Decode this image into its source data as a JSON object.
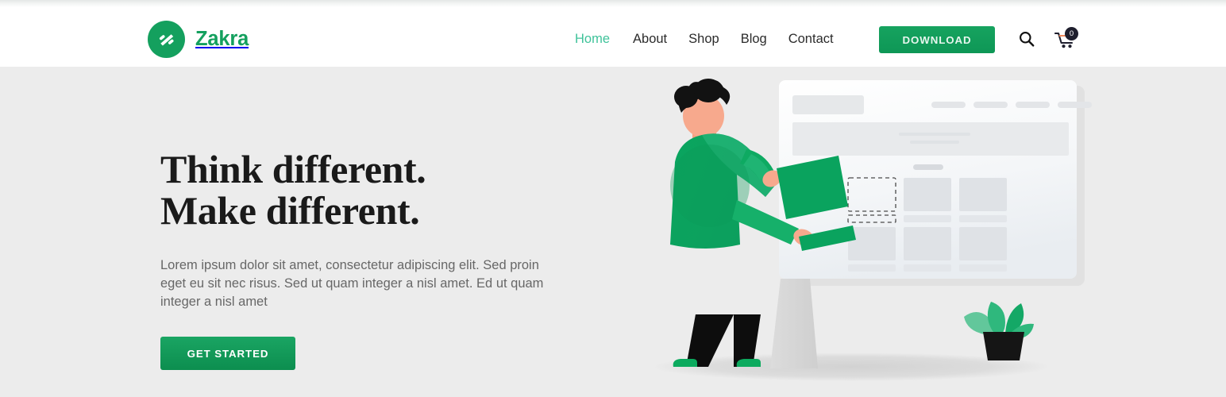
{
  "brand": {
    "name": "Zakra",
    "logo_icon": "zakra-logo-icon",
    "color": "#14a05e"
  },
  "nav": {
    "items": [
      {
        "label": "Home",
        "active": true
      },
      {
        "label": "About",
        "active": false
      },
      {
        "label": "Shop",
        "active": false
      },
      {
        "label": "Blog",
        "active": false
      },
      {
        "label": "Contact",
        "active": false
      }
    ]
  },
  "header_actions": {
    "download_label": "DOWNLOAD",
    "search_icon": "search-icon",
    "cart_icon": "shopping-cart-icon",
    "cart_count": "0"
  },
  "hero": {
    "title_line1": "Think different.",
    "title_line2": "Make different.",
    "description": "Lorem ipsum dolor sit amet, consectetur adipiscing elit. Sed proin eget eu sit nec risus. Sed ut quam integer a nisl amet.  Ed ut quam integer a nisl amet",
    "cta_label": "GET STARTED",
    "illustration": "website-builder-illustration",
    "background": "#ececec"
  },
  "colors": {
    "brand_green": "#14a05e",
    "active_nav": "#3fc39a",
    "hero_bg": "#ececec",
    "heading": "#1a1a1a",
    "body_text": "#676767"
  }
}
